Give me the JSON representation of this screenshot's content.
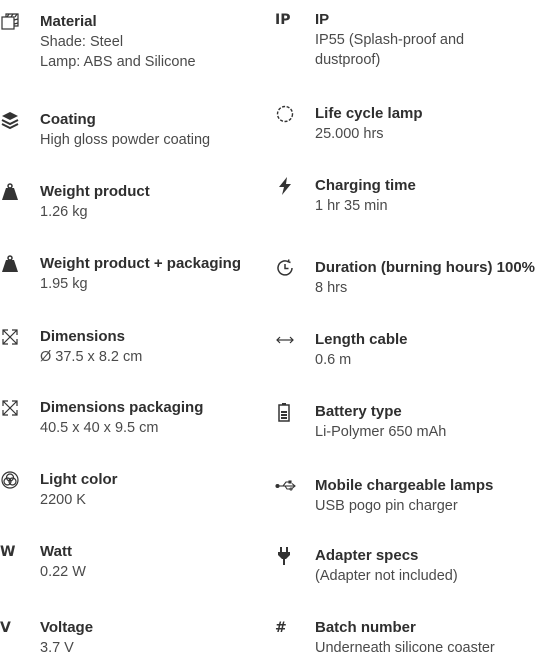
{
  "left": [
    {
      "icon": "material-icon",
      "title": "Material",
      "lines": [
        "Shade: Steel",
        "Lamp: ABS and Silicone"
      ]
    },
    {
      "icon": "coating-layers-icon",
      "title": "Coating",
      "lines": [
        "High gloss powder coating"
      ]
    },
    {
      "icon": "weight-icon",
      "title": "Weight product",
      "lines": [
        "1.26 kg"
      ]
    },
    {
      "icon": "weight-icon",
      "title": "Weight product + packaging",
      "lines": [
        "1.95 kg"
      ]
    },
    {
      "icon": "dimensions-icon",
      "title": "Dimensions",
      "lines": [
        "Ø 37.5 x 8.2 cm"
      ]
    },
    {
      "icon": "dimensions-icon",
      "title": "Dimensions packaging",
      "lines": [
        "40.5 x 40 x 9.5 cm"
      ]
    },
    {
      "icon": "light-color-icon",
      "title": "Light color",
      "lines": [
        "2200 K"
      ]
    },
    {
      "icon": "watt-letter-icon",
      "glyph": "W",
      "title": "Watt",
      "lines": [
        "0.22 W"
      ]
    },
    {
      "icon": "voltage-letter-icon",
      "glyph": "V",
      "title": "Voltage",
      "lines": [
        "3.7 V"
      ]
    }
  ],
  "right": [
    {
      "icon": "ip-letter-icon",
      "glyph": "IP",
      "title": "IP",
      "lines": [
        "IP55 (Splash-proof and",
        "dustproof)"
      ]
    },
    {
      "icon": "life-cycle-icon",
      "title": "Life cycle lamp",
      "lines": [
        "25.000 hrs"
      ]
    },
    {
      "icon": "charging-bolt-icon",
      "title": "Charging time",
      "lines": [
        "1 hr 35 min"
      ]
    },
    {
      "icon": "duration-clock-icon",
      "title": "Duration (burning hours) 100%",
      "lines": [
        "8 hrs"
      ]
    },
    {
      "icon": "length-arrow-icon",
      "title": "Length cable",
      "lines": [
        "0.6 m"
      ]
    },
    {
      "icon": "battery-icon",
      "title": "Battery type",
      "lines": [
        "Li-Polymer 650 mAh"
      ]
    },
    {
      "icon": "usb-icon",
      "title": "Mobile chargeable lamps",
      "lines": [
        "USB pogo pin charger"
      ]
    },
    {
      "icon": "plug-icon",
      "title": "Adapter specs",
      "lines": [
        "(Adapter not included)"
      ]
    },
    {
      "icon": "hash-icon",
      "glyph": "#",
      "title": "Batch number",
      "lines": [
        "Underneath silicone coaster"
      ]
    }
  ]
}
